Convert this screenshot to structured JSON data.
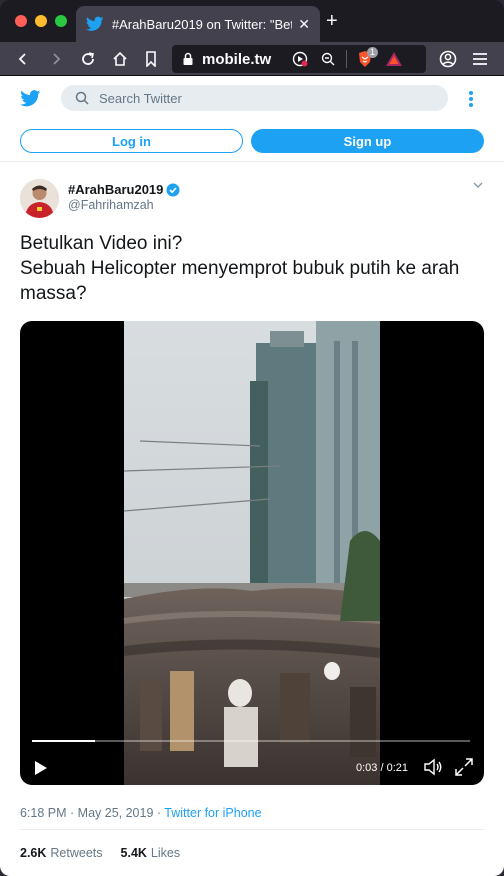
{
  "browser": {
    "tab_title": "#ArahBaru2019 on Twitter: \"Betu",
    "url": "mobile.tw",
    "badge_count": "1"
  },
  "twitter": {
    "search_placeholder": "Search Twitter",
    "login_label": "Log in",
    "signup_label": "Sign up",
    "brand_color": "#1da1f2"
  },
  "tweet": {
    "display_name": "#ArahBaru2019",
    "handle": "@Fahrihamzah",
    "text_line1": "Betulkan Video ini?",
    "text_line2": "Sebuah Helicopter menyemprot bubuk putih ke arah massa?",
    "video_time": "0:03 / 0:21",
    "video_progress": 0.143,
    "timestamp": "6:18 PM · May 25, 2019 · ",
    "source": "Twitter for iPhone",
    "retweets_count": "2.6K",
    "retweets_label": "Retweets",
    "likes_count": "5.4K",
    "likes_label": "Likes"
  }
}
